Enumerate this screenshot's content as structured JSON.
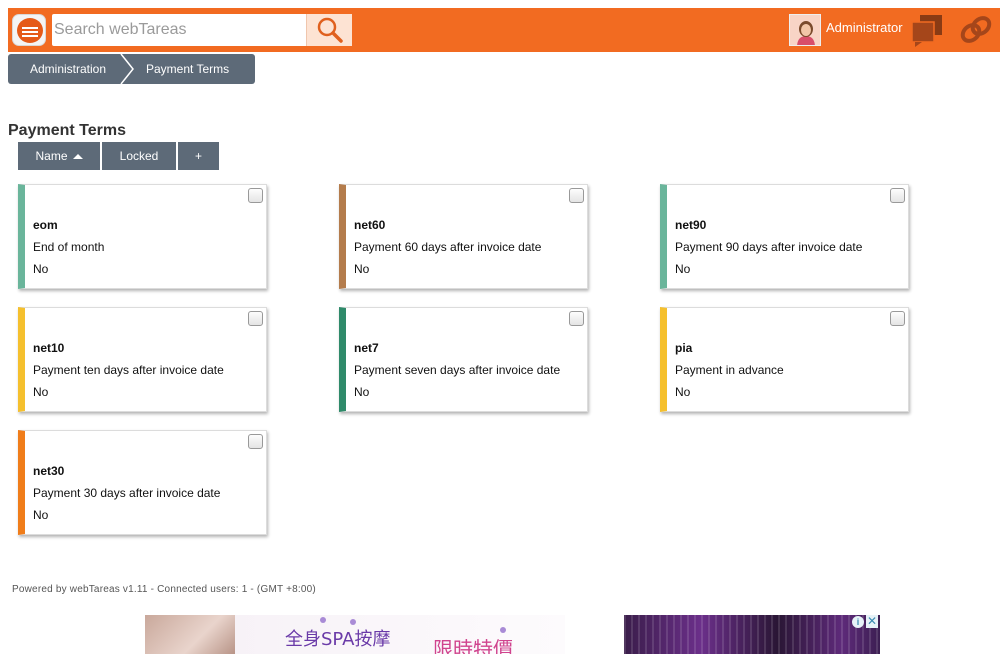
{
  "header": {
    "search_placeholder": "Search webTareas",
    "user_name": "Administrator",
    "icons": [
      "menu-icon",
      "search-icon",
      "avatar",
      "chat-icon",
      "link-icon"
    ],
    "accent_color": "#f26b21"
  },
  "breadcrumb": {
    "items": [
      {
        "label": "Administration"
      },
      {
        "label": "Payment Terms"
      }
    ]
  },
  "page": {
    "title": "Payment Terms"
  },
  "sort_buttons": {
    "name_label": "Name",
    "locked_label": "Locked",
    "add_label": "+"
  },
  "cards": [
    {
      "code": "eom",
      "description": "End of month",
      "locked": "No",
      "color": "#6ab59b"
    },
    {
      "code": "net60",
      "description": "Payment 60 days after invoice date",
      "locked": "No",
      "color": "#b47c4c"
    },
    {
      "code": "net90",
      "description": "Payment 90 days after invoice date",
      "locked": "No",
      "color": "#6ab59b"
    },
    {
      "code": "net10",
      "description": "Payment ten days after invoice date",
      "locked": "No",
      "color": "#f5c02e"
    },
    {
      "code": "net7",
      "description": "Payment seven days after invoice date",
      "locked": "No",
      "color": "#2f8a6a"
    },
    {
      "code": "pia",
      "description": "Payment in advance",
      "locked": "No",
      "color": "#f5c02e"
    },
    {
      "code": "net30",
      "description": "Payment 30 days after invoice date",
      "locked": "No",
      "color": "#f07d1a"
    }
  ],
  "footer": {
    "text": "Powered by webTareas v1.11 - Connected users: 1 - (GMT +8:00)"
  },
  "ads": {
    "left_text_1": "全身SPA按摩",
    "left_text_2": "限時特價",
    "info_label": "i",
    "close_label": "✕"
  }
}
